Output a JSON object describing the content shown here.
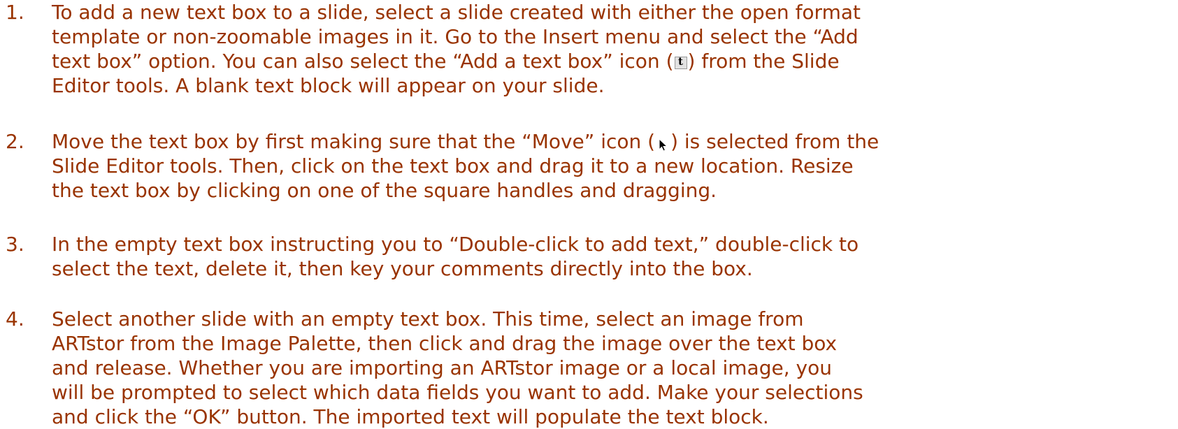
{
  "steps": [
    {
      "number": "1.",
      "lines": [
        "To add a new text box to a slide, select a slide created with either the open format",
        "template or non-zoomable images in it. Go to the Insert menu and select the “Add",
        "text box” option. You can also select the “Add a text box” icon (",
        ") from the Slide",
        "Editor tools. A blank text block will appear on your slide."
      ]
    },
    {
      "number": "2.",
      "lines": [
        "Move the text box by first making sure that the “Move” icon (",
        ") is selected from the",
        "Slide Editor tools. Then, click on the text box and drag it to a new location.  Resize",
        "the text box by clicking on one of the square handles and dragging."
      ]
    },
    {
      "number": "3.",
      "lines": [
        "In the empty text box instructing you to “Double-click to add text,” double-click to",
        "select the text, delete it, then key your comments directly into the box."
      ]
    },
    {
      "number": "4.",
      "lines": [
        "Select another slide with an empty text box.  This time, select an image from",
        "ARTstor from the Image Palette, then click and drag the image over the text box",
        "and release.  Whether you are importing an ARTstor image or a local image, you",
        "will be prompted to select which data fields you want to add. Make your selections",
        "and click the “OK” button. The imported text will populate the text block."
      ]
    }
  ],
  "icons": {
    "text_box_icon_letter": "t",
    "text_box_icon_name": "add-text-box-icon",
    "move_icon_name": "move-cursor-icon"
  },
  "colors": {
    "text": "#993300",
    "background": "#ffffff"
  }
}
